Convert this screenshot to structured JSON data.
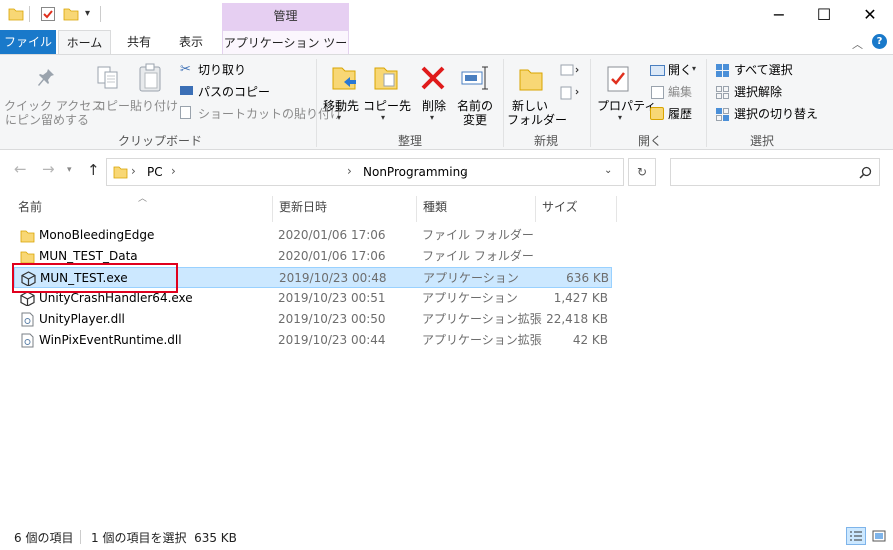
{
  "titlebar": {
    "context_header": "管理",
    "minimize": "−",
    "maximize": "☐",
    "close": "✕"
  },
  "tabs": {
    "file": "ファイル",
    "home": "ホーム",
    "share": "共有",
    "view": "表示",
    "app_tools": "アプリケーション ツール"
  },
  "ribbon": {
    "clipboard": {
      "pin_line1": "クイック アクセス",
      "pin_line2": "にピン留めする",
      "copy": "コピー",
      "paste": "貼り付け",
      "cut": "切り取り",
      "copy_path": "パスのコピー",
      "paste_shortcut": "ショートカットの貼り付け",
      "label": "クリップボード"
    },
    "organize": {
      "move_to": "移動先",
      "copy_to": "コピー先",
      "delete": "削除",
      "rename_line1": "名前の",
      "rename_line2": "変更",
      "label": "整理"
    },
    "new": {
      "new_folder_line1": "新しい",
      "new_folder_line2": "フォルダー",
      "label": "新規"
    },
    "open": {
      "properties": "プロパティ",
      "open": "開く",
      "edit": "編集",
      "history": "履歴",
      "label": "開く"
    },
    "select": {
      "select_all": "すべて選択",
      "select_none": "選択解除",
      "invert": "選択の切り替え",
      "label": "選択"
    }
  },
  "address": {
    "crumbs": [
      "PC",
      "NonProgramming"
    ],
    "sep": "›"
  },
  "columns": {
    "name": "名前",
    "modified": "更新日時",
    "type": "種類",
    "size": "サイズ"
  },
  "files": [
    {
      "name": "MonoBleedingEdge",
      "modified": "2020/01/06 17:06",
      "type": "ファイル フォルダー",
      "size": "",
      "icon": "folder-icon"
    },
    {
      "name": "MUN_TEST_Data",
      "modified": "2020/01/06 17:06",
      "type": "ファイル フォルダー",
      "size": "",
      "icon": "folder-icon"
    },
    {
      "name": "MUN_TEST.exe",
      "modified": "2019/10/23 00:48",
      "type": "アプリケーション",
      "size": "636 KB",
      "icon": "unity-app-icon"
    },
    {
      "name": "UnityCrashHandler64.exe",
      "modified": "2019/10/23 00:51",
      "type": "アプリケーション",
      "size": "1,427 KB",
      "icon": "unity-app-icon"
    },
    {
      "name": "UnityPlayer.dll",
      "modified": "2019/10/23 00:50",
      "type": "アプリケーション拡張",
      "size": "22,418 KB",
      "icon": "dll-file-icon"
    },
    {
      "name": "WinPixEventRuntime.dll",
      "modified": "2019/10/23 00:44",
      "type": "アプリケーション拡張",
      "size": "42 KB",
      "icon": "dll-file-icon"
    }
  ],
  "status": {
    "item_count": "6 個の項目",
    "selection": "1 個の項目を選択  635 KB"
  },
  "colors": {
    "file_tab": "#1979ca",
    "context_header": "#e6cff2",
    "selection": "#cce8ff",
    "highlight_box": "#e0001e"
  }
}
